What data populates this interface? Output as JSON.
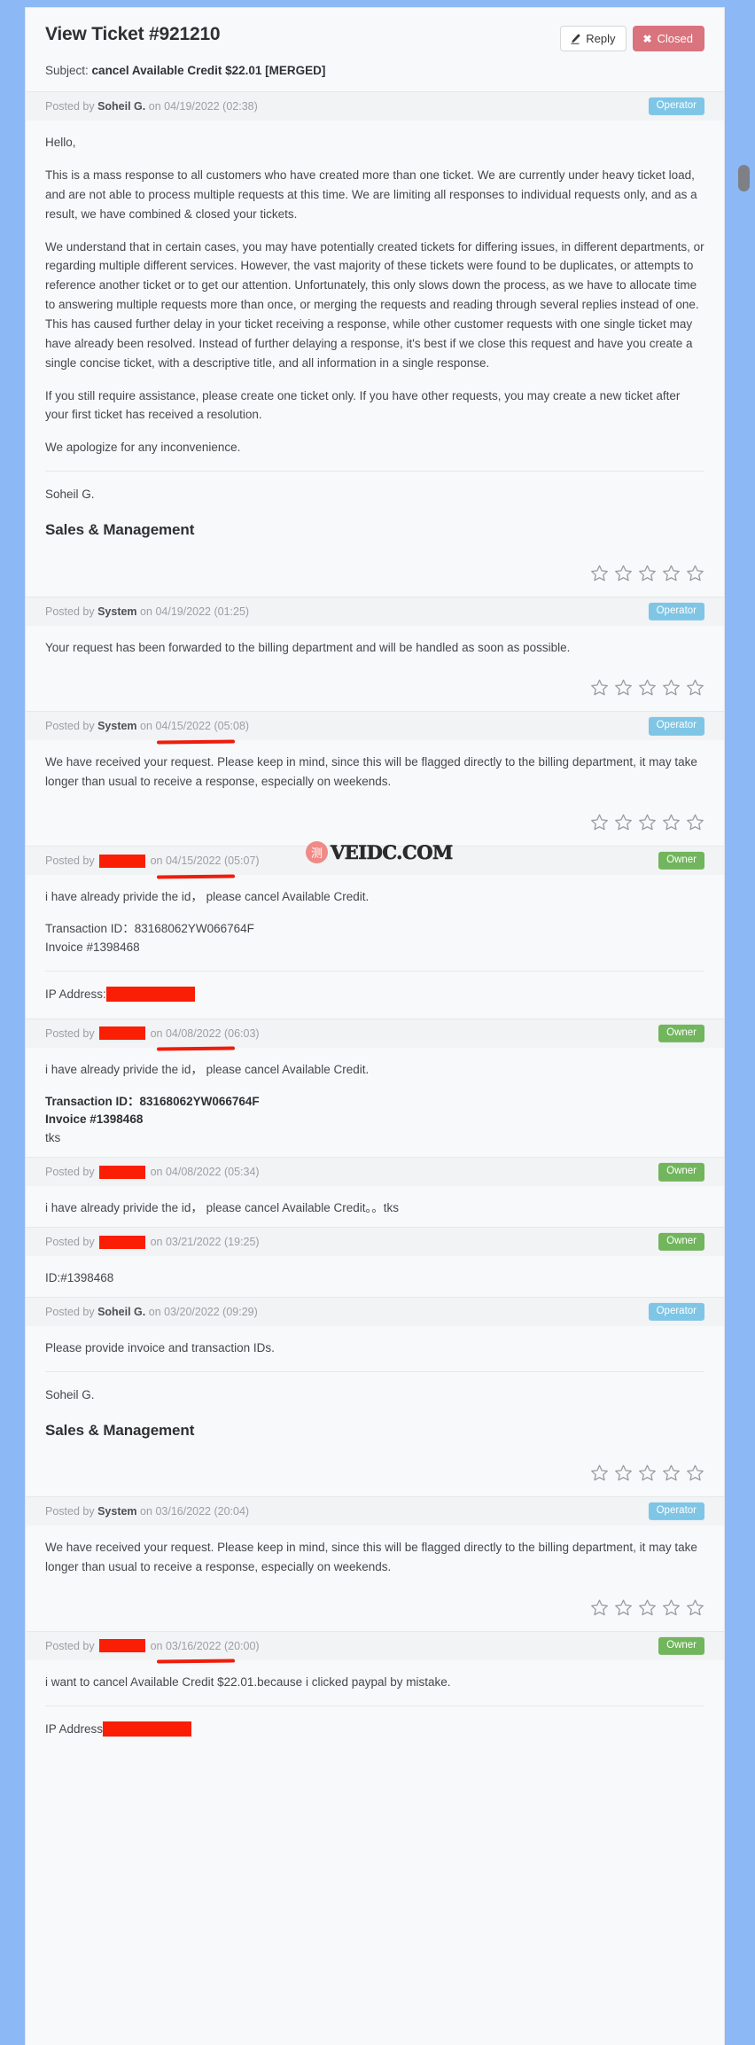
{
  "page": {
    "background_color": "#8cb8f5",
    "panel_color": "#f8f9fb"
  },
  "header": {
    "title": "View Ticket #921210",
    "subject_label": "Subject:",
    "subject_value": "cancel Available Credit $22.01 [MERGED]",
    "reply_button": "Reply",
    "closed_button": "Closed",
    "reply_icon": "pencil-icon",
    "closed_icon": "close-x-icon"
  },
  "watermark": {
    "glyph": "测",
    "text": "VEIDC.COM"
  },
  "badges": {
    "operator": "Operator",
    "owner": "Owner",
    "operator_color": "#7ec5e6",
    "owner_color": "#71b55c"
  },
  "meta_labels": {
    "posted_by": "Posted by",
    "on": "on",
    "redacted": ""
  },
  "signature": {
    "name": "Soheil G.",
    "department": "Sales & Management"
  },
  "ip_label": "IP Address:",
  "ip_label_no_colon": "IP Address",
  "posts": [
    {
      "author": "Soheil G.",
      "author_redacted": false,
      "date": "04/19/2022 (02:38)",
      "role": "Operator",
      "has_stars": true,
      "paragraphs": [
        "Hello,",
        "This is a mass response to all customers who have created more than one ticket. We are currently under heavy ticket load, and are not able to process multiple requests at this time. We are limiting all responses to individual requests only, and as a result, we have combined & closed your tickets.",
        "We understand that in certain cases, you may have potentially created tickets for differing issues, in different departments, or regarding multiple different services. However, the vast majority of these tickets were found to be duplicates, or attempts to reference another ticket or to get our attention. Unfortunately, this only slows down the process, as we have to allocate time to answering multiple requests more than once, or merging the requests and reading through several replies instead of one. This has caused further delay in your ticket receiving a response, while other customer requests with one single ticket may have already been resolved. Instead of further delaying a response, it's best if we close this request and have you create a single concise ticket, with a descriptive title, and all information in a single response.",
        "If you still require assistance, please create one ticket only. If you have other requests, you may create a new ticket after your first ticket has received a resolution.",
        "We apologize for any inconvenience."
      ],
      "signature_name": "Soheil G.",
      "signature_dept": "Sales & Management"
    },
    {
      "author": "System",
      "author_redacted": false,
      "date": "04/19/2022 (01:25)",
      "role": "Operator",
      "has_stars": true,
      "paragraphs": [
        "Your request has been forwarded to the billing department and will be handled as soon as possible."
      ]
    },
    {
      "author": "System",
      "author_redacted": false,
      "date": "04/15/2022 (05:08)",
      "role": "Operator",
      "has_stars": true,
      "underlined_date": true,
      "paragraphs": [
        "We have received your request. Please keep in mind, since this will be flagged directly to the billing department, it may take longer than usual to receive a response, especially on weekends."
      ]
    },
    {
      "author": "",
      "author_redacted": true,
      "date": "04/15/2022 (05:07)",
      "role": "Owner",
      "has_stars": false,
      "underlined_date": true,
      "has_watermark": true,
      "paragraphs": [
        "i have already privide the id， please cancel Available Credit."
      ],
      "detail_lines": [
        "Transaction ID：83168062YW066764F",
        "Invoice #1398468"
      ],
      "detail_bold": false,
      "ip_address_redacted": true
    },
    {
      "author": "",
      "author_redacted": true,
      "date": "04/08/2022 (06:03)",
      "role": "Owner",
      "has_stars": false,
      "underlined_date": true,
      "paragraphs": [
        "i have already privide the id， please cancel Available Credit."
      ],
      "detail_lines": [
        "Transaction ID：83168062YW066764F",
        "Invoice #1398468",
        "tks"
      ],
      "detail_bold": true
    },
    {
      "author": "",
      "author_redacted": true,
      "date": "04/08/2022 (05:34)",
      "role": "Owner",
      "has_stars": false,
      "paragraphs": [
        "i have already privide the id， please cancel Available Credit。。tks"
      ]
    },
    {
      "author": "",
      "author_redacted": true,
      "date": "03/21/2022 (19:25)",
      "role": "Owner",
      "has_stars": false,
      "paragraphs": [
        "ID:#1398468"
      ]
    },
    {
      "author": "Soheil G.",
      "author_redacted": false,
      "date": "03/20/2022 (09:29)",
      "role": "Operator",
      "has_stars": true,
      "paragraphs": [
        "Please provide invoice and transaction IDs."
      ],
      "signature_name": "Soheil G.",
      "signature_dept": "Sales & Management"
    },
    {
      "author": "System",
      "author_redacted": false,
      "date": "03/16/2022 (20:04)",
      "role": "Operator",
      "has_stars": true,
      "paragraphs": [
        "We have received your request. Please keep in mind, since this will be flagged directly to the billing department, it may take longer than usual to receive a response, especially on weekends."
      ]
    },
    {
      "author": "",
      "author_redacted": true,
      "date": "03/16/2022 (20:00)",
      "role": "Owner",
      "has_stars": false,
      "underlined_date": true,
      "paragraphs": [
        "i want to cancel Available Credit $22.01.because i clicked paypal by mistake."
      ],
      "ip_address_redacted": true,
      "ip_no_colon": true
    }
  ]
}
